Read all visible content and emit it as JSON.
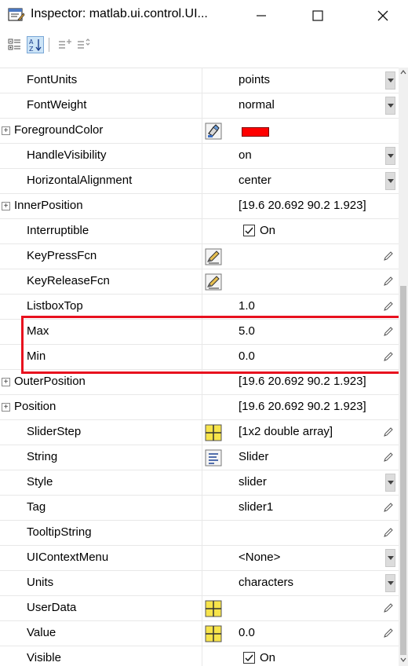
{
  "window": {
    "title": "Inspector:  matlab.ui.control.UI..."
  },
  "toolbar": {
    "buttons": [
      {
        "icon": "categorized-view-icon",
        "pressed": false
      },
      {
        "icon": "sort-alphabetical-icon",
        "pressed": true
      },
      {
        "icon": "expand-all-icon",
        "pressed": false
      },
      {
        "icon": "collapse-all-icon",
        "pressed": false
      }
    ]
  },
  "highlight": {
    "color": "#e8101e",
    "rows": [
      "Max",
      "Min"
    ]
  },
  "properties": [
    {
      "name": "FontUnits",
      "value": "points",
      "control": "dropdown"
    },
    {
      "name": "FontWeight",
      "value": "normal",
      "control": "dropdown"
    },
    {
      "name": "ForegroundColor",
      "expandable": true,
      "icon": "color-picker-icon",
      "swatch": "#ff0000"
    },
    {
      "name": "HandleVisibility",
      "value": "on",
      "control": "dropdown"
    },
    {
      "name": "HorizontalAlignment",
      "value": "center",
      "control": "dropdown"
    },
    {
      "name": "InnerPosition",
      "expandable": true,
      "value": "[19.6 20.692 90.2 1.923]"
    },
    {
      "name": "Interruptible",
      "checkbox": true,
      "value": "On"
    },
    {
      "name": "KeyPressFcn",
      "icon": "callback-editor-icon",
      "control": "pencil"
    },
    {
      "name": "KeyReleaseFcn",
      "icon": "callback-editor-icon",
      "control": "pencil"
    },
    {
      "name": "ListboxTop",
      "value": "1.0",
      "control": "pencil"
    },
    {
      "name": "Max",
      "value": "5.0",
      "control": "pencil"
    },
    {
      "name": "Min",
      "value": "0.0",
      "control": "pencil"
    },
    {
      "name": "OuterPosition",
      "expandable": true,
      "value": "[19.6 20.692 90.2 1.923]"
    },
    {
      "name": "Position",
      "expandable": true,
      "value": "[19.6 20.692 90.2 1.923]"
    },
    {
      "name": "SliderStep",
      "icon": "array-editor-icon",
      "value": "[1x2  double array]",
      "control": "pencil"
    },
    {
      "name": "String",
      "icon": "text-editor-icon",
      "value": "Slider",
      "control": "pencil"
    },
    {
      "name": "Style",
      "value": "slider",
      "control": "dropdown"
    },
    {
      "name": "Tag",
      "value": "slider1",
      "control": "pencil"
    },
    {
      "name": "TooltipString",
      "control": "pencil"
    },
    {
      "name": "UIContextMenu",
      "value": "<None>",
      "control": "dropdown"
    },
    {
      "name": "Units",
      "value": "characters",
      "control": "dropdown"
    },
    {
      "name": "UserData",
      "icon": "array-editor-icon",
      "control": "pencil"
    },
    {
      "name": "Value",
      "icon": "array-editor-icon",
      "value": "0.0",
      "control": "pencil"
    },
    {
      "name": "Visible",
      "checkbox": true,
      "value": "On"
    }
  ]
}
